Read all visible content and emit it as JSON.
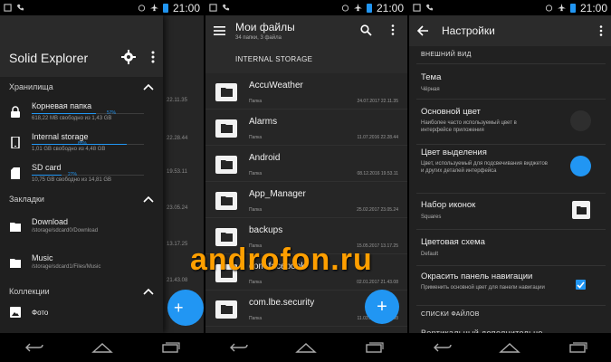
{
  "status_time": "21:00",
  "colors": {
    "accent": "#2196f3",
    "watermark": "#ff9f00"
  },
  "panel1": {
    "app_title": "Solid Explorer",
    "sections": {
      "storage": "Хранилища",
      "bookmarks": "Закладки",
      "collections": "Коллекции"
    },
    "storages": [
      {
        "name": "Корневая папка",
        "sub": "618,22 MB свободно из 1,43 GB",
        "pct_label": "57%",
        "used": 0.57
      },
      {
        "name": "Internal storage",
        "sub": "1,01 GB свободно из 4,48 GB",
        "pct_label": "85%",
        "used": 0.85
      },
      {
        "name": "SD card",
        "sub": "10,75 GB свободно из 14,81 GB",
        "pct_label": "27%",
        "used": 0.27
      }
    ],
    "bookmarks": [
      {
        "name": "Download",
        "path": "/storage/sdcard0/Download"
      },
      {
        "name": "Music",
        "path": "/storage/sdcard1/Files/Music"
      }
    ],
    "collections": [
      {
        "name": "Фото"
      }
    ],
    "bg_dates": [
      "22.11.35",
      "22.28.44",
      "19.53.11",
      "23.05.24",
      "13.17.25",
      "21.43.08"
    ],
    "fab_label": "+"
  },
  "panel2": {
    "title": "Мои файлы",
    "subtitle": "34 папки, 3 файла",
    "storage_label": "INTERNAL STORAGE",
    "files": [
      {
        "name": "AccuWeather",
        "type": "Папка",
        "date": "24.07.2017 22.11.35"
      },
      {
        "name": "Alarms",
        "type": "Папка",
        "date": "11.07.2016 22.28.44"
      },
      {
        "name": "Android",
        "type": "Папка",
        "date": "08.12.2016 19.53.11"
      },
      {
        "name": "App_Manager",
        "type": "Папка",
        "date": "25.02.2017 23.05.24"
      },
      {
        "name": "backups",
        "type": "Папка",
        "date": "15.05.2017 13.17.25"
      },
      {
        "name": "com.facebook",
        "type": "Папка",
        "date": "02.01.2017 21.43.08"
      },
      {
        "name": "com.lbe.security",
        "type": "Папка",
        "date": "11.03.2017 21.43.08"
      }
    ],
    "fab_label": "+"
  },
  "panel3": {
    "title": "Настройки",
    "section_appearance": "ВНЕШНИЙ ВИД",
    "section_files": "СПИСКИ ФАЙЛОВ",
    "theme": {
      "title": "Тема",
      "value": "Чёрная"
    },
    "primary_color": {
      "title": "Основной цвет",
      "desc": "Наиболее часто используемый цвет в интерфейсе приложения",
      "color": "#2e2e2e"
    },
    "highlight_color": {
      "title": "Цвет выделения",
      "desc": "Цвет, используемый для подсвечивания виджетов и других деталей интерфейса",
      "color": "#2196f3"
    },
    "icon_set": {
      "title": "Набор иконок",
      "value": "Squares"
    },
    "color_scheme": {
      "title": "Цветовая схема",
      "value": "Default"
    },
    "nav_color": {
      "title": "Окрасить панель навигации",
      "desc": "Применить основной цвет для панели навигации",
      "checked": true
    },
    "cut_item": "Вертикальный дополнительно"
  },
  "watermark": "androfon.ru"
}
